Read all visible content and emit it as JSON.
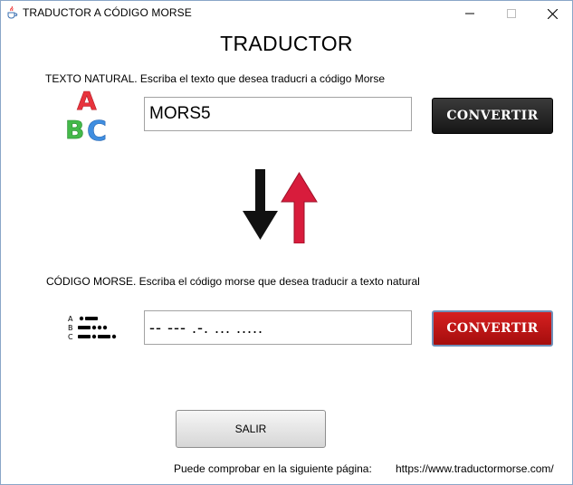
{
  "window": {
    "title": "TRADUCTOR A CÓDIGO MORSE",
    "controls": {
      "minimize": "—",
      "maximize": "☐",
      "close": "✕"
    }
  },
  "main": {
    "heading": "TRADUCTOR",
    "natural_section": {
      "label": "TEXTO NATURAL. Escriba el texto que desea traducri a código Morse",
      "input_value": "MORS5",
      "convert_label": "CONVERTIR",
      "icon": "abc-blocks-icon"
    },
    "arrows_icon": "swap-arrows-icon",
    "morse_section": {
      "label": "CÓDIGO MORSE. Escriba el código morse que desea traducir a texto natural",
      "input_value": "-- --- .-. ... .....",
      "convert_label": "CONVERTIR",
      "icon": "morse-code-icon",
      "icon_letters": [
        "A",
        "B",
        "C"
      ]
    },
    "exit_label": "SALIR",
    "footer": {
      "text": "Puede comprobar en la siguiente página:",
      "url": "https://www.traductormorse.com/"
    }
  },
  "colors": {
    "dark_button": "#1e1e1e",
    "red_button": "#c41414",
    "arrow_down": "#111111",
    "arrow_up": "#d81c3c",
    "block_a": "#e8333c",
    "block_b": "#43b949",
    "block_c": "#3f8ee0"
  }
}
